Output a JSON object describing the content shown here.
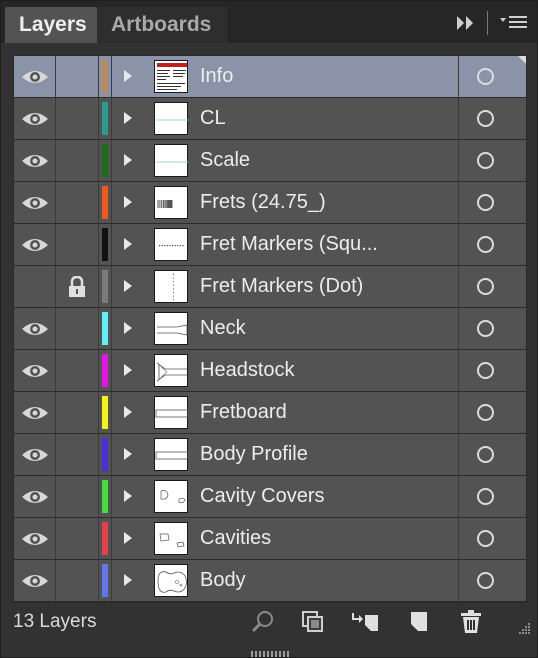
{
  "tabs": [
    {
      "label": "Layers",
      "active": true
    },
    {
      "label": "Artboards",
      "active": false
    }
  ],
  "tab_controls": {
    "collapse_icon": "double-chevron-right-icon",
    "menu_icon": "panel-menu-icon"
  },
  "layers": [
    {
      "name": "Info",
      "color": "#b98a5c",
      "visible": true,
      "locked": false,
      "selected": true,
      "thumb": "info"
    },
    {
      "name": "CL",
      "color": "#2d9a90",
      "visible": true,
      "locked": false,
      "selected": false,
      "thumb": "hline"
    },
    {
      "name": "Scale",
      "color": "#1a6f1a",
      "visible": true,
      "locked": false,
      "selected": false,
      "thumb": "hline"
    },
    {
      "name": "Frets (24.75_)",
      "color": "#ee5a1a",
      "visible": true,
      "locked": false,
      "selected": false,
      "thumb": "frets"
    },
    {
      "name": "Fret Markers (Squ...",
      "color": "#111111",
      "visible": true,
      "locked": false,
      "selected": false,
      "thumb": "dots"
    },
    {
      "name": "Fret Markers (Dot)",
      "color": "#7b7b7b",
      "visible": false,
      "locked": true,
      "selected": false,
      "thumb": "vdots"
    },
    {
      "name": "Neck",
      "color": "#5ff0f5",
      "visible": true,
      "locked": false,
      "selected": false,
      "thumb": "neck"
    },
    {
      "name": "Headstock",
      "color": "#e614e6",
      "visible": true,
      "locked": false,
      "selected": false,
      "thumb": "headstock"
    },
    {
      "name": "Fretboard",
      "color": "#f5f514",
      "visible": true,
      "locked": false,
      "selected": false,
      "thumb": "fretboard"
    },
    {
      "name": "Body Profile",
      "color": "#4a2fdc",
      "visible": true,
      "locked": false,
      "selected": false,
      "thumb": "fretboard"
    },
    {
      "name": "Cavity Covers",
      "color": "#44e03a",
      "visible": true,
      "locked": false,
      "selected": false,
      "thumb": "covers"
    },
    {
      "name": "Cavities",
      "color": "#e8404a",
      "visible": true,
      "locked": false,
      "selected": false,
      "thumb": "cavities"
    },
    {
      "name": "Body",
      "color": "#5f78f0",
      "visible": true,
      "locked": false,
      "selected": false,
      "thumb": "body"
    }
  ],
  "footer": {
    "count_label": "13 Layers",
    "icons": [
      "locate-object-icon",
      "make-clipping-mask-icon",
      "create-sublayer-icon",
      "create-new-layer-icon",
      "delete-layer-icon"
    ]
  }
}
